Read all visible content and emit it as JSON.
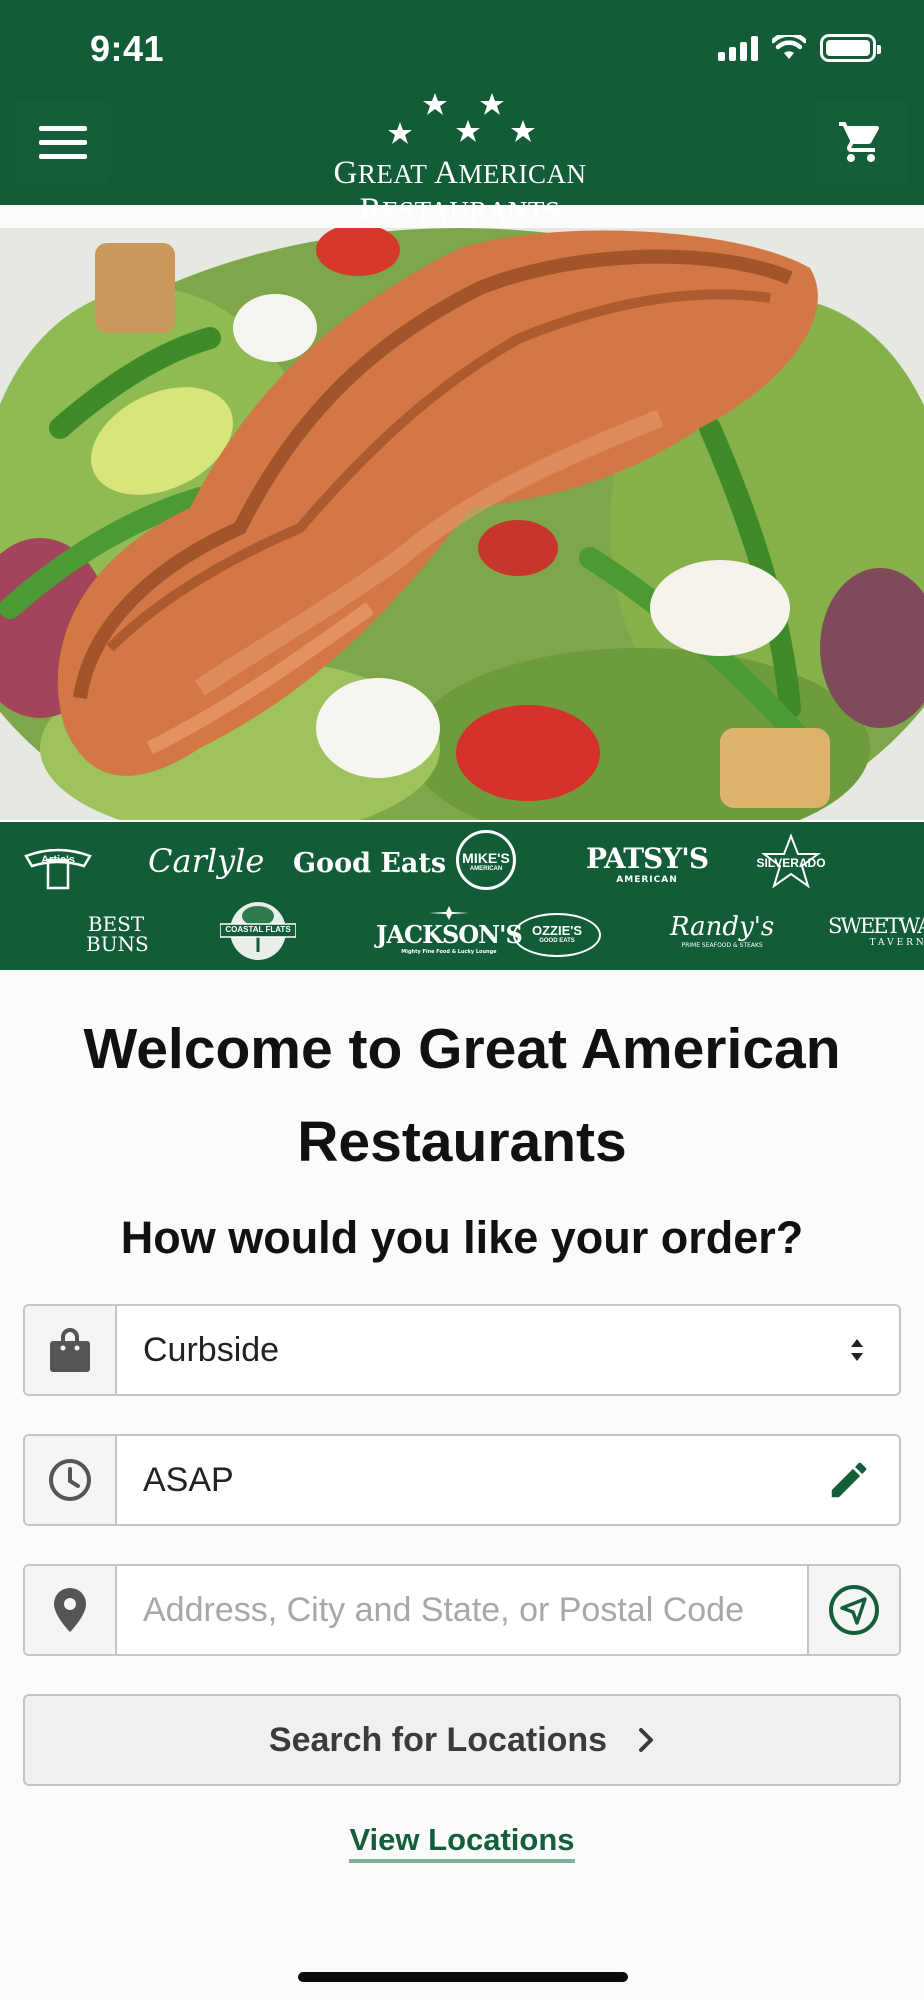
{
  "status_bar": {
    "time": "9:41"
  },
  "header": {
    "logo_text_part1": "G",
    "logo_text_part2": "REAT ",
    "logo_text_part3": "A",
    "logo_text_part4": "MERICAN ",
    "logo_text_part5": "R",
    "logo_text_part6": "ESTAURANTS",
    "menu_icon": "hamburger-icon",
    "cart_icon": "cart-icon",
    "brand_color": "#135c38"
  },
  "brands": {
    "row1": [
      "Artie's",
      "Carlyle",
      "Good Eats",
      "MIKE'S",
      "PATSY'S",
      "SILVERADO"
    ],
    "row2": [
      "BEST BUNS",
      "COASTAL FLATS",
      "JACKSON'S",
      "OZZIE'S",
      "Randy's",
      "SWEETWATER"
    ],
    "sub": {
      "mikes": "AMERICAN",
      "patsys": "AMERICAN",
      "jacksons": "Mighty Fine Food & Lucky Lounge",
      "ozzies": "GOOD EATS",
      "randys": "PRIME SEAFOOD & STEAKS",
      "sweetwater": "TAVERN"
    }
  },
  "content": {
    "welcome_line1": "Welcome to Great American",
    "welcome_line2": "Restaurants",
    "question": "How would you like your order?",
    "order_type": {
      "value": "Curbside",
      "icon": "shopping-bag-icon"
    },
    "order_time": {
      "value": "ASAP",
      "icon": "clock-icon",
      "edit_icon": "pencil-icon"
    },
    "address": {
      "placeholder": "Address, City and State, or Postal Code",
      "icon": "map-pin-icon",
      "locate_icon": "navigation-icon"
    },
    "search_button": "Search for Locations",
    "view_locations": "View Locations",
    "accent_color": "#155e3a"
  }
}
